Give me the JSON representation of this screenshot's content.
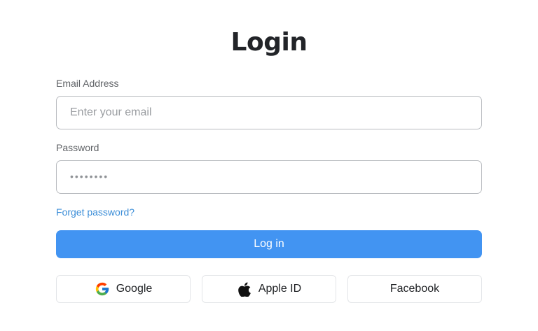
{
  "form": {
    "title": "Login",
    "email": {
      "label": "Email Address",
      "placeholder": "Enter your email",
      "value": ""
    },
    "password": {
      "label": "Password",
      "placeholder": "••••••••",
      "value": ""
    },
    "forgot_link": "Forget password?",
    "submit_label": "Log in"
  },
  "social": {
    "google": {
      "label": "Google",
      "icon": "google-icon"
    },
    "apple": {
      "label": "Apple ID",
      "icon": "apple-icon"
    },
    "facebook": {
      "label": "Facebook"
    }
  },
  "colors": {
    "primary": "#4294f2",
    "link": "#3c8ed8",
    "border": "#b9bcc0"
  }
}
